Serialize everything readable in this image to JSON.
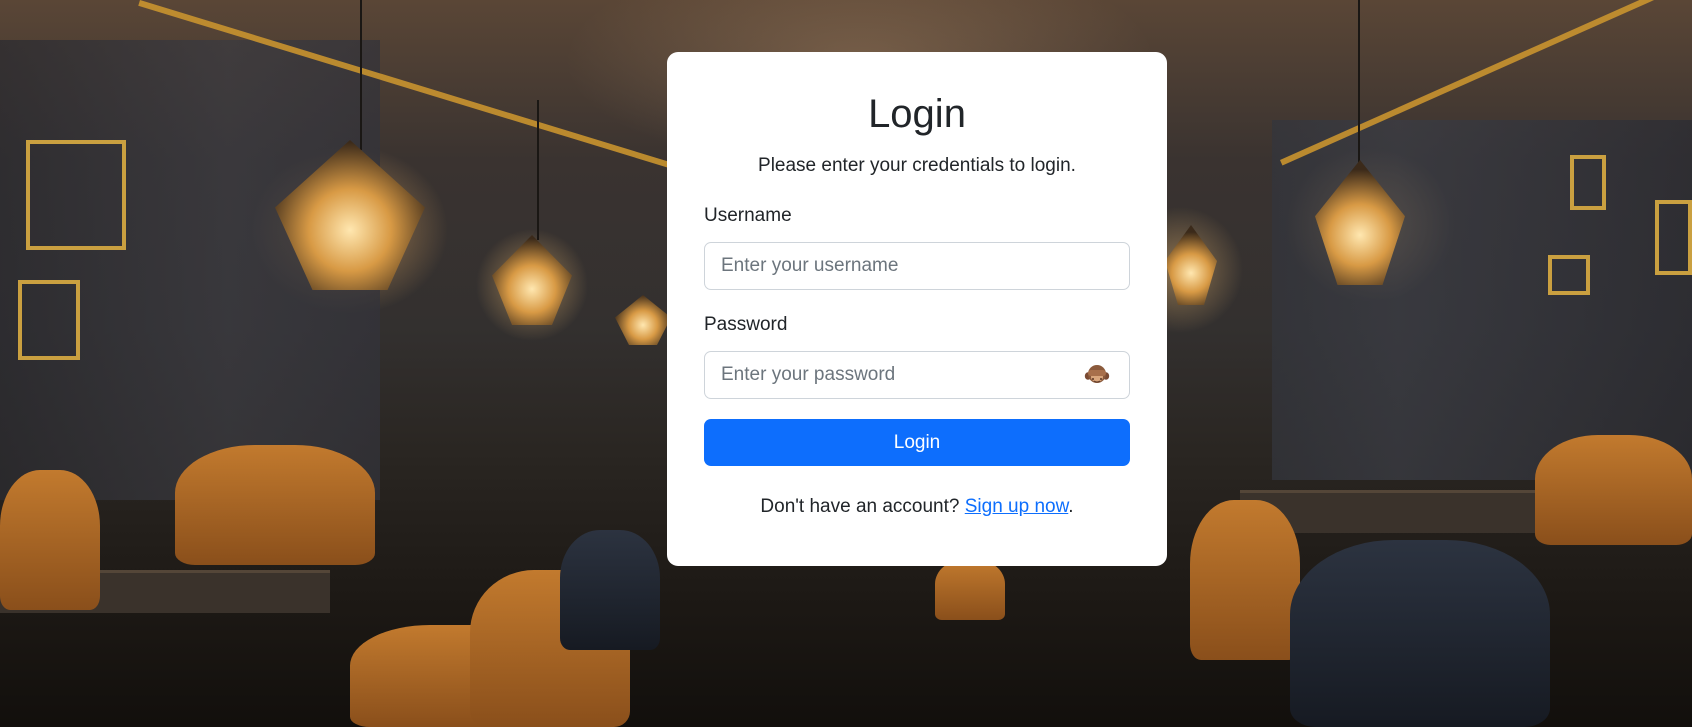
{
  "login": {
    "title": "Login",
    "subtitle": "Please enter your credentials to login.",
    "username_label": "Username",
    "username_placeholder": "Enter your username",
    "username_value": "",
    "password_label": "Password",
    "password_placeholder": "Enter your password",
    "password_value": "",
    "password_toggle_icon": "see-no-evil-monkey-icon",
    "submit_label": "Login",
    "footer_text": "Don't have an account?",
    "signup_link": "Sign up now",
    "footer_end": "."
  },
  "colors": {
    "primary": "#0d6efd",
    "card_bg": "#ffffff",
    "text": "#212529",
    "placeholder": "#6c757d"
  }
}
